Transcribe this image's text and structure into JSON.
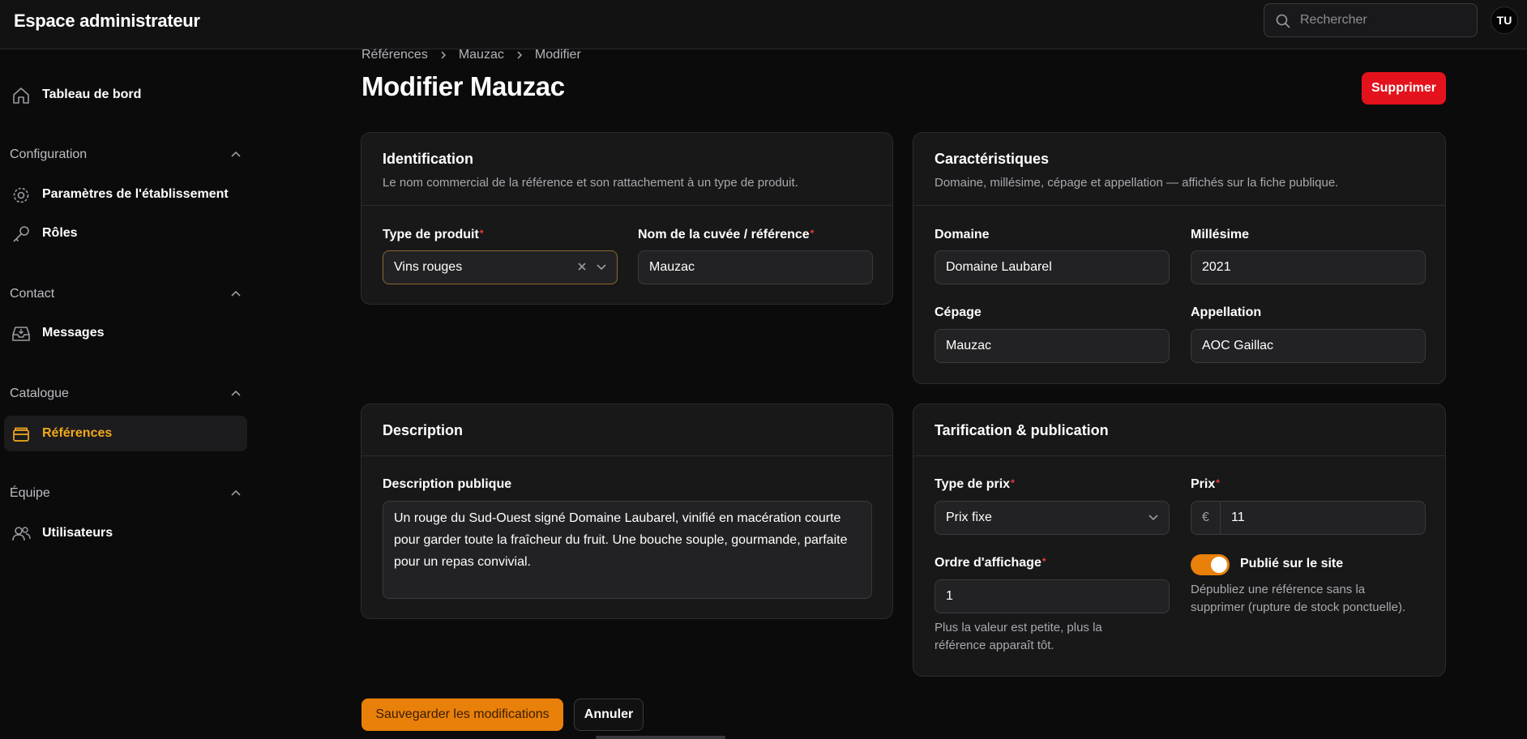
{
  "header": {
    "app_title": "Espace administrateur",
    "search_placeholder": "Rechercher",
    "avatar_initials": "TU"
  },
  "sidebar": {
    "dashboard": "Tableau de bord",
    "groups": [
      {
        "label": "Configuration",
        "items": [
          "Paramètres de l'établissement",
          "Rôles"
        ]
      },
      {
        "label": "Contact",
        "items": [
          "Messages"
        ]
      },
      {
        "label": "Catalogue",
        "items": [
          "Références"
        ]
      },
      {
        "label": "Équipe",
        "items": [
          "Utilisateurs"
        ]
      }
    ],
    "active_item": "Références",
    "accent_color": "#f2a91c"
  },
  "breadcrumb": [
    "Références",
    "Mauzac",
    "Modifier"
  ],
  "page": {
    "title": "Modifier Mauzac",
    "delete_label": "Supprimer"
  },
  "identification": {
    "title": "Identification",
    "subtitle": "Le nom commercial de la référence et son rattachement à un type de produit.",
    "product_type_label": "Type de produit",
    "product_type_value": "Vins rouges",
    "name_label": "Nom de la cuvée / référence",
    "name_value": "Mauzac"
  },
  "characteristics": {
    "title": "Caractéristiques",
    "subtitle": "Domaine, millésime, cépage et appellation — affichés sur la fiche publique.",
    "domain_label": "Domaine",
    "domain_value": "Domaine Laubarel",
    "vintage_label": "Millésime",
    "vintage_value": "2021",
    "grape_label": "Cépage",
    "grape_value": "Mauzac",
    "appellation_label": "Appellation",
    "appellation_value": "AOC Gaillac"
  },
  "description": {
    "title": "Description",
    "public_label": "Description publique",
    "public_value": "Un rouge du Sud-Ouest signé Domaine Laubarel, vinifié en macération courte pour garder toute la fraîcheur du fruit. Une bouche souple, gourmande, parfaite pour un repas convivial."
  },
  "pricing": {
    "title": "Tarification & publication",
    "price_type_label": "Type de prix",
    "price_type_value": "Prix fixe",
    "price_label": "Prix",
    "currency": "€",
    "price_value": "11",
    "order_label": "Ordre d'affichage",
    "order_value": "1",
    "order_help": "Plus la valeur est petite, plus la référence apparaît tôt.",
    "published_label": "Publié sur le site",
    "published_on": true,
    "published_help": "Dépubliez une référence sans la supprimer (rupture de stock ponctuelle).",
    "toggle_color": "#e8800a"
  },
  "actions": {
    "save_label": "Sauvegarder les modifications",
    "cancel_label": "Annuler"
  },
  "required_marker": "*"
}
